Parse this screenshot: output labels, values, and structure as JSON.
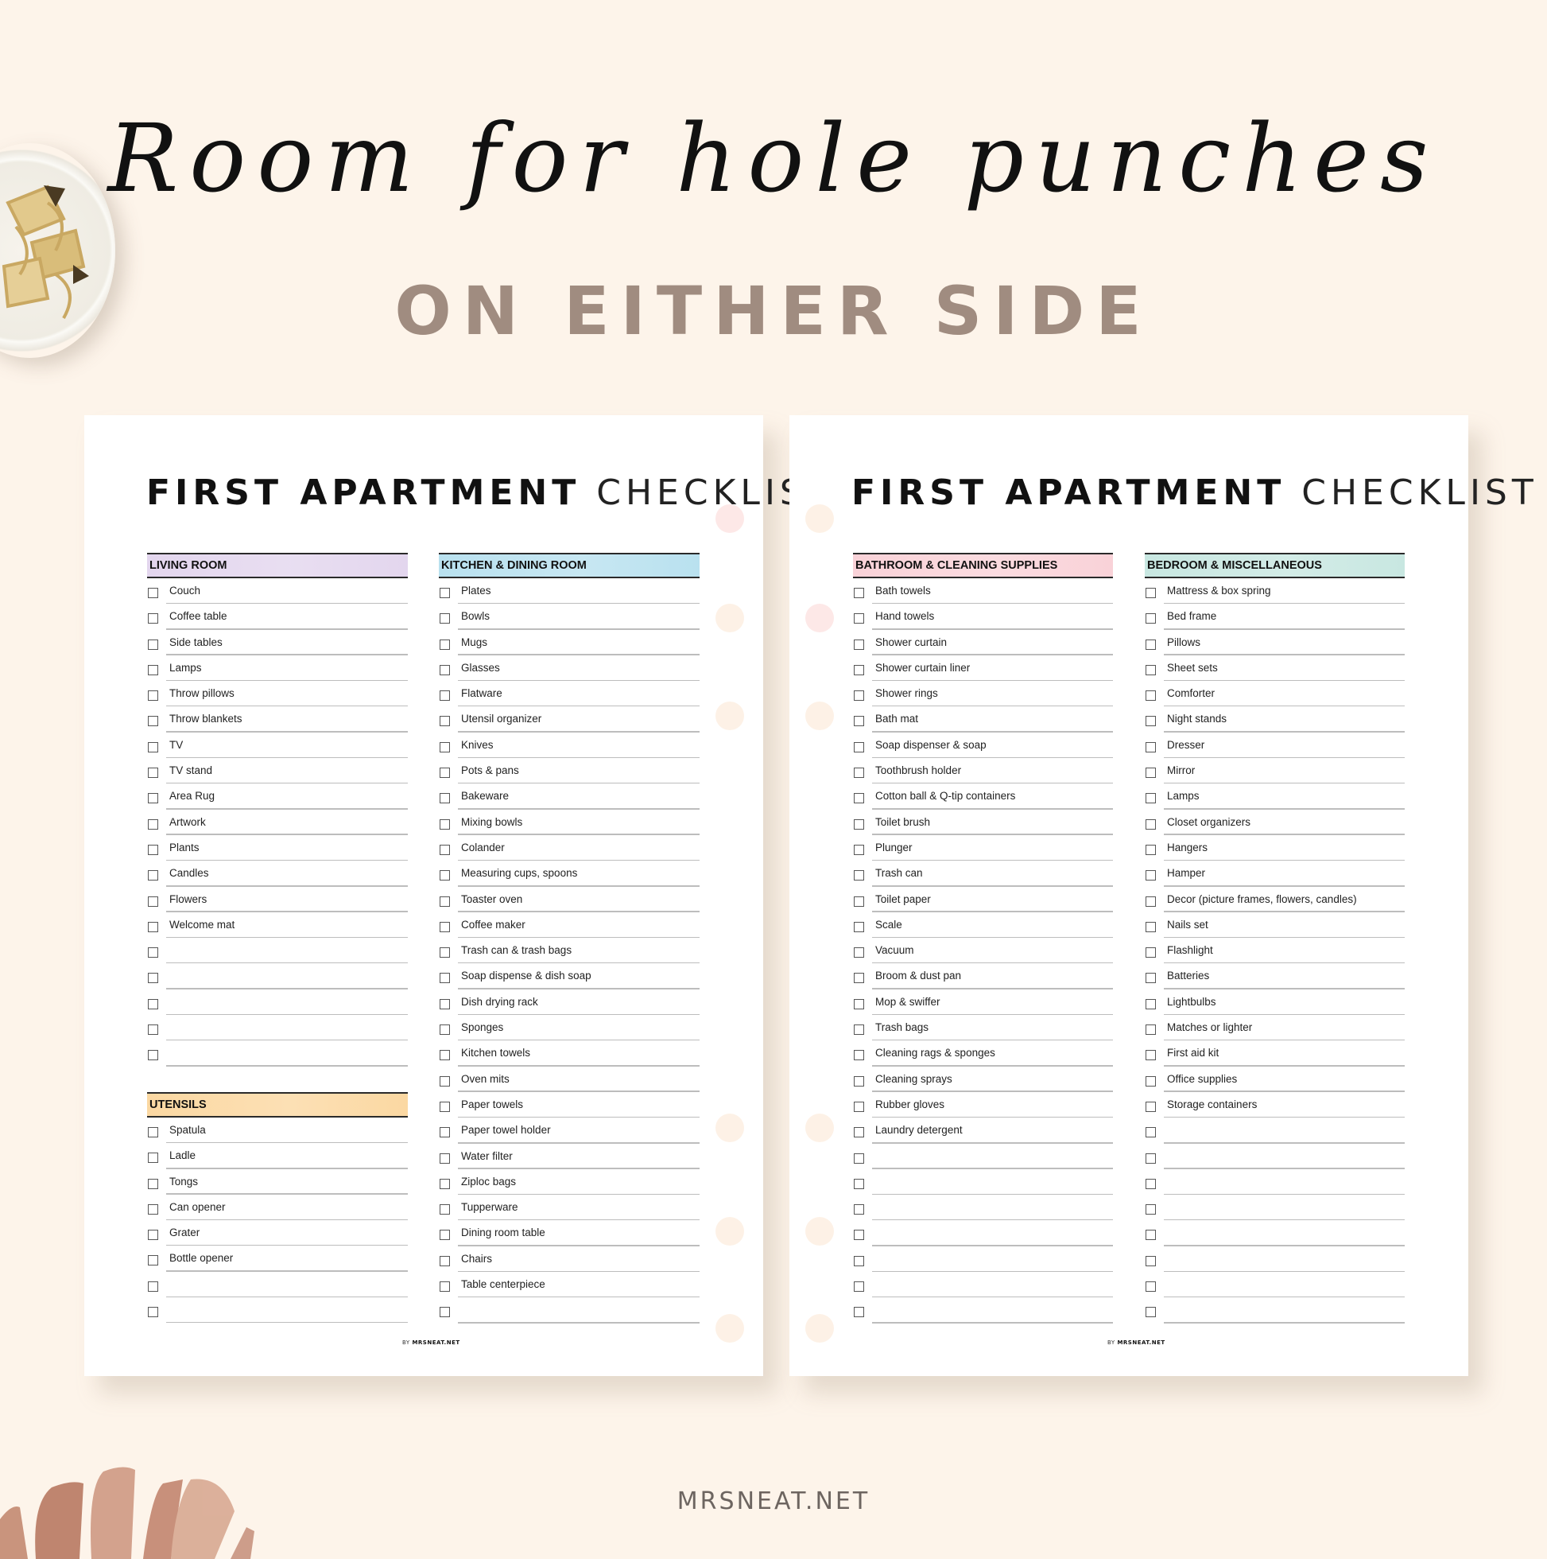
{
  "banner": {
    "script_title": "Room for hole punches",
    "subtitle": "ON EITHER SIDE",
    "brand": "MRSNEAT.NET"
  },
  "colors": {
    "background": "#fdf4ea",
    "subtitle": "#a08c80",
    "living_room": "#e3d6ee",
    "kitchen": "#b9e1ef",
    "utensils": "#fbd8a2",
    "bathroom": "#f9d2d8",
    "bedroom": "#c8e7e1",
    "hole_pink": "#fde8e7",
    "hole_peach": "#fdf1e6"
  },
  "pages": [
    {
      "title_bold": "FIRST APARTMENT",
      "title_light": "CHECKLIST",
      "footer_by": "BY",
      "footer_brand": "MRSNEAT.NET",
      "sections": [
        {
          "title": "LIVING ROOM",
          "items": [
            "Couch",
            "Coffee table",
            "Side tables",
            "Lamps",
            "Throw pillows",
            "Throw blankets",
            "TV",
            "TV stand",
            "Area Rug",
            "Artwork",
            "Plants",
            "Candles",
            "Flowers",
            "Welcome mat",
            "",
            "",
            "",
            "",
            ""
          ]
        },
        {
          "title": "UTENSILS",
          "items": [
            "Spatula",
            "Ladle",
            "Tongs",
            "Can opener",
            "Grater",
            "Bottle opener",
            "",
            ""
          ]
        },
        {
          "title": "KITCHEN & DINING ROOM",
          "items": [
            "Plates",
            "Bowls",
            "Mugs",
            "Glasses",
            "Flatware",
            "Utensil organizer",
            "Knives",
            "Pots & pans",
            "Bakeware",
            "Mixing bowls",
            "Colander",
            "Measuring cups, spoons",
            "Toaster oven",
            "Coffee maker",
            "Trash can & trash bags",
            "Soap dispense & dish soap",
            "Dish drying rack",
            "Sponges",
            "Kitchen towels",
            "Oven mits",
            "Paper towels",
            "Paper towel holder",
            "Water filter",
            "Ziploc bags",
            "Tupperware",
            "Dining room table",
            "Chairs",
            "Table centerpiece",
            ""
          ]
        }
      ]
    },
    {
      "title_bold": "FIRST APARTMENT",
      "title_light": "CHECKLIST",
      "footer_by": "BY",
      "footer_brand": "MRSNEAT.NET",
      "sections": [
        {
          "title": "BATHROOM & CLEANING SUPPLIES",
          "items": [
            "Bath towels",
            "Hand towels",
            "Shower curtain",
            "Shower curtain liner",
            "Shower rings",
            "Bath mat",
            "Soap dispenser & soap",
            "Toothbrush holder",
            "Cotton ball & Q-tip containers",
            "Toilet brush",
            "Plunger",
            "Trash can",
            "Toilet paper",
            "Scale",
            "Vacuum",
            "Broom & dust pan",
            "Mop & swiffer",
            "Trash bags",
            "Cleaning rags & sponges",
            "Cleaning sprays",
            "Rubber gloves",
            "Laundry detergent",
            "",
            "",
            "",
            "",
            "",
            "",
            ""
          ]
        },
        {
          "title": "BEDROOM & MISCELLANEOUS",
          "items": [
            "Mattress & box spring",
            "Bed frame",
            "Pillows",
            "Sheet sets",
            "Comforter",
            "Night stands",
            "Dresser",
            "Mirror",
            "Lamps",
            "Closet organizers",
            "Hangers",
            "Hamper",
            "Decor (picture frames, flowers, candles)",
            "Nails set",
            "Flashlight",
            "Batteries",
            "Lightbulbs",
            "Matches or lighter",
            "First aid kit",
            "Office supplies",
            "Storage containers",
            "",
            "",
            "",
            "",
            "",
            "",
            "",
            ""
          ]
        }
      ]
    }
  ]
}
